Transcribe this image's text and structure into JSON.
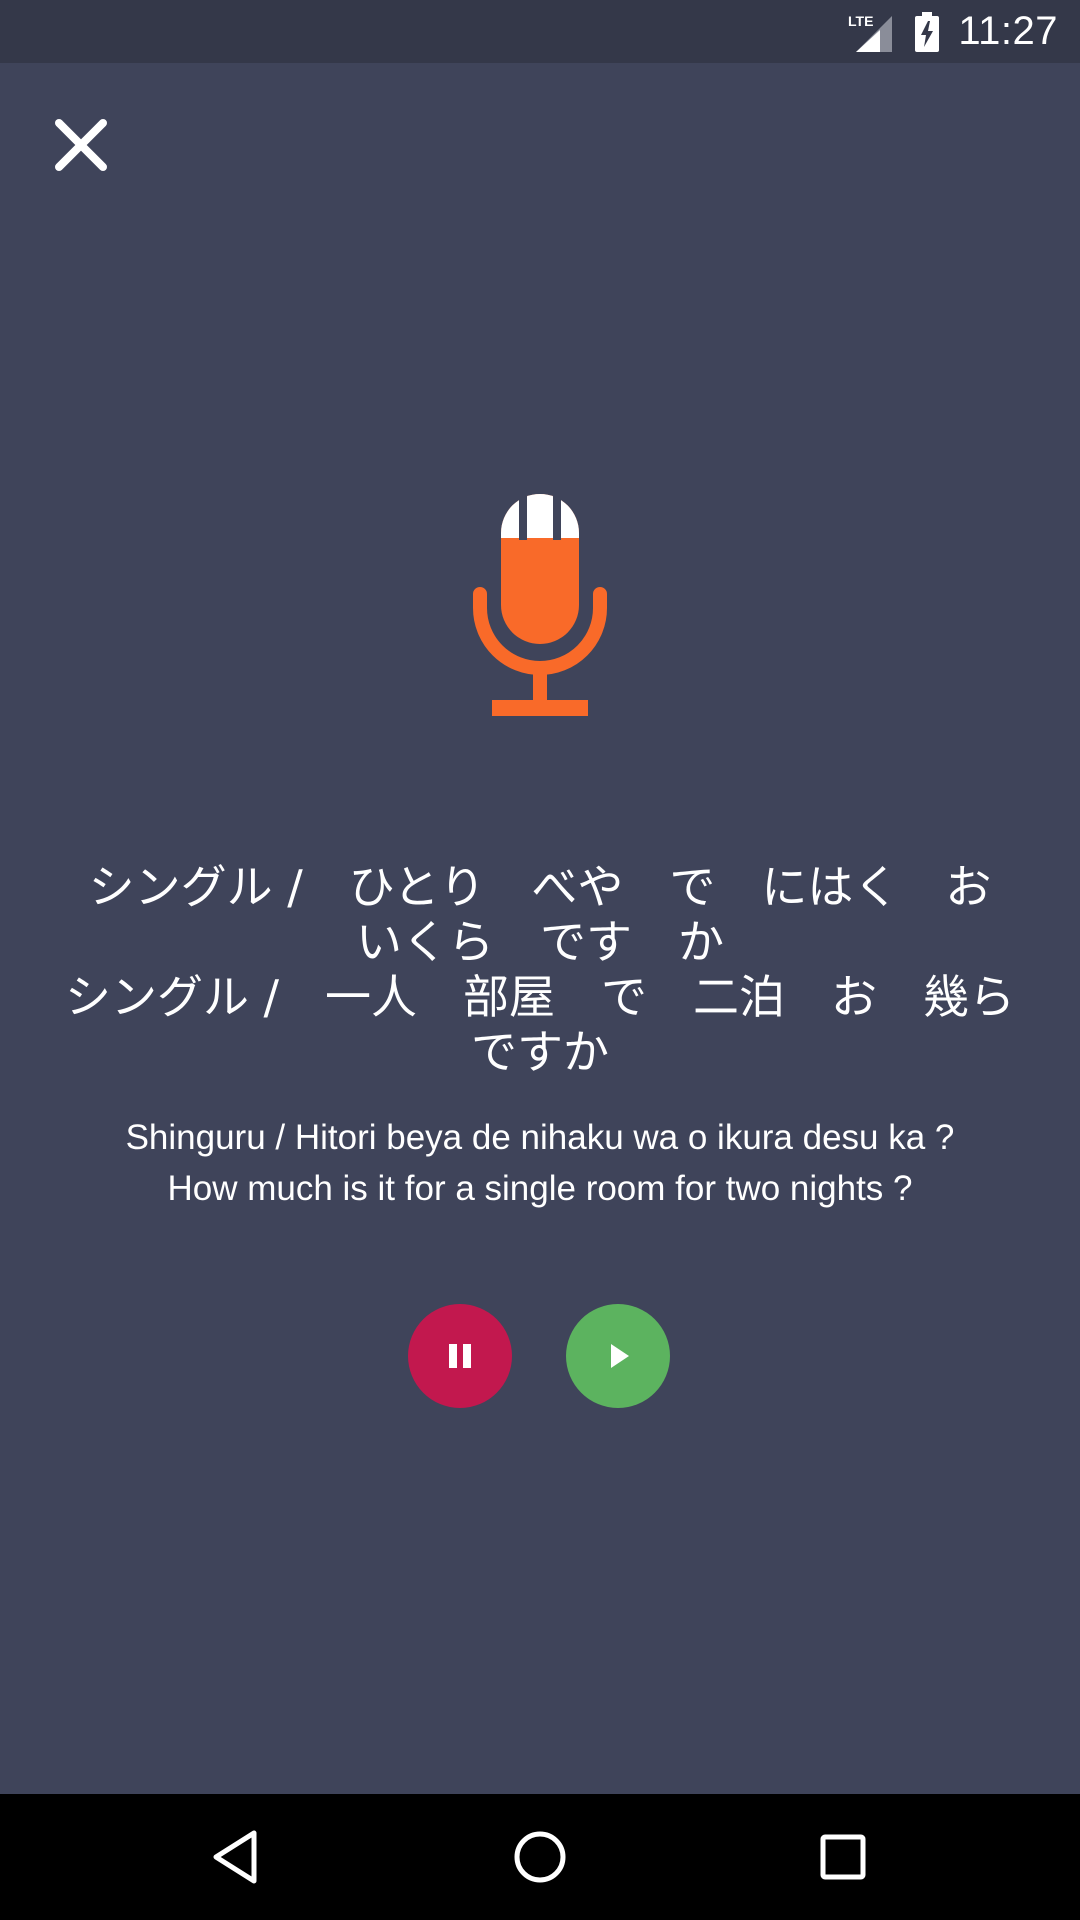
{
  "status_bar": {
    "network_label": "LTE",
    "time": "11:27"
  },
  "icons": {
    "close": "close-icon",
    "mic": "microphone-icon",
    "pause": "pause-icon",
    "play": "play-icon",
    "back": "nav-back-icon",
    "home": "nav-home-icon",
    "recents": "nav-recents-icon"
  },
  "colors": {
    "background": "#3f445a",
    "status_bar": "#343849",
    "mic": "#f96a29",
    "pause_button": "#c2184e",
    "play_button": "#5cb35f",
    "nav_bar": "#000000"
  },
  "phrase": {
    "kana_line_1": "シングル /　ひとり　べや　で　にはく　お",
    "kana_line_2": "いくら　です　か",
    "kanji_line_1": "シングル /　一人　部屋　で　二泊　お　幾ら",
    "kanji_line_2": "ですか",
    "romaji": "Shinguru / Hitori beya de nihaku wa o ikura desu ka ?",
    "translation": "How much is it for a single room for two nights ?"
  }
}
